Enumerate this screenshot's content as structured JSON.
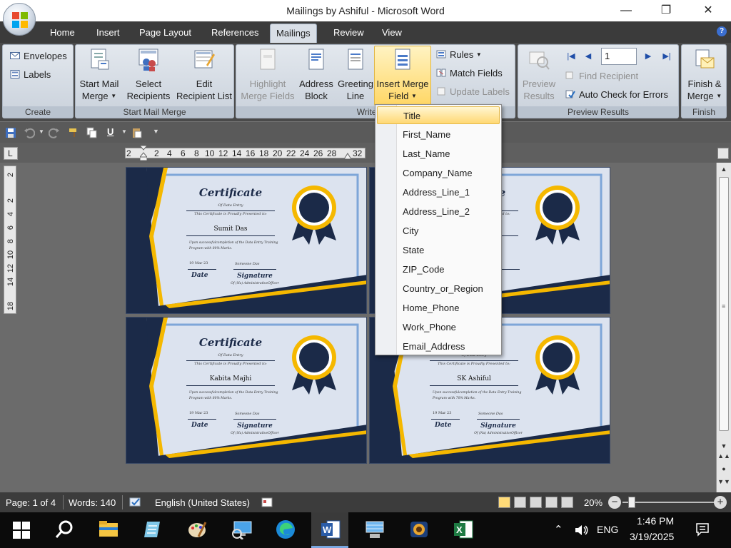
{
  "window": {
    "title": "Mailings by Ashiful - Microsoft Word",
    "controls": {
      "minimize": "—",
      "restore": "❐",
      "close": "✕"
    }
  },
  "tabs": [
    {
      "label": "Home"
    },
    {
      "label": "Insert"
    },
    {
      "label": "Page Layout"
    },
    {
      "label": "References"
    },
    {
      "label": "Mailings",
      "active": true
    },
    {
      "label": "Review"
    },
    {
      "label": "View"
    }
  ],
  "ribbon": {
    "create": {
      "label": "Create",
      "envelopes": "Envelopes",
      "labels": "Labels"
    },
    "start_mail_merge": {
      "label": "Start Mail Merge",
      "start_line1": "Start Mail",
      "start_line2": "Merge",
      "select_line1": "Select",
      "select_line2": "Recipients",
      "edit_line1": "Edit",
      "edit_line2": "Recipient List"
    },
    "write_insert": {
      "label": "Write & In",
      "highlight_line1": "Highlight",
      "highlight_line2": "Merge Fields",
      "address_line1": "Address",
      "address_line2": "Block",
      "greeting_line1": "Greeting",
      "greeting_line2": "Line",
      "insert_line1": "Insert Merge",
      "insert_line2": "Field",
      "rules": "Rules",
      "match_fields": "Match Fields",
      "update_labels": "Update Labels"
    },
    "preview": {
      "label": "Preview Results",
      "preview_line1": "Preview",
      "preview_line2": "Results",
      "record_value": "1",
      "find_recipient": "Find Recipient",
      "auto_check": "Auto Check for Errors"
    },
    "finish": {
      "label": "Finish",
      "finish_line1": "Finish &",
      "finish_line2": "Merge"
    }
  },
  "ruler": {
    "h_ticks": [
      "2",
      "2",
      "4",
      "6",
      "8",
      "10",
      "12",
      "14",
      "16",
      "18",
      "20",
      "22",
      "24",
      "26",
      "28",
      "32"
    ],
    "v_ticks": [
      "2",
      "2",
      "4",
      "6",
      "8",
      "10",
      "12",
      "14",
      "18"
    ]
  },
  "insert_merge_dropdown": {
    "items": [
      {
        "label": "Title",
        "highlighted": true
      },
      {
        "label": "First_Name"
      },
      {
        "label": "Last_Name"
      },
      {
        "label": "Company_Name"
      },
      {
        "label": "Address_Line_1"
      },
      {
        "label": "Address_Line_2"
      },
      {
        "label": "City"
      },
      {
        "label": "State"
      },
      {
        "label": "ZIP_Code"
      },
      {
        "label": "Country_or_Region"
      },
      {
        "label": "Home_Phone"
      },
      {
        "label": "Work_Phone"
      },
      {
        "label": "Email_Address"
      }
    ]
  },
  "certificates": [
    {
      "title": "Certificate",
      "subtitle": "Of Data Entry",
      "presented": "This Certificate is Proudly Presented to:",
      "name": "Sumit Das",
      "body": "Upon successfulcompletion of the Data Entry Training Program with 80% Marks.",
      "date": "19 Mar 23",
      "signature_hand": "Someone Das",
      "date_label": "Date",
      "signature_label": "Signature",
      "role": "Of (Na) AdministrativeOfficer"
    },
    {
      "title": "Certificate",
      "subtitle": "Of Data Entry",
      "presented": "This Certificate is Proudly Presented to:",
      "name": "",
      "body": "",
      "date": "",
      "signature_hand": "",
      "date_label": "",
      "signature_label": "",
      "role": ""
    },
    {
      "title": "Certificate",
      "subtitle": "Of Data Entry",
      "presented": "This Certificate is Proudly Presented to:",
      "name": "Kabita Majhi",
      "body": "Upon successfulcompletion of the Data Entry Training Program with 80% Marks.",
      "date": "19 Mar 23",
      "signature_hand": "Someone Das",
      "date_label": "Date",
      "signature_label": "Signature",
      "role": "Of (Na) AdministrativeOfficer"
    },
    {
      "title": "",
      "subtitle": "Of Data Entry",
      "presented": "This Certificate is Proudly Presented to:",
      "name": "SK Ashiful",
      "body": "Upon successfulcompletion of the Data Entry Training Program with 70% Marks.",
      "date": "19 Mar 23",
      "signature_hand": "Someone Das",
      "date_label": "Date",
      "signature_label": "Signature",
      "role": "Of (Na) AdministrativeOfficer"
    }
  ],
  "status_bar": {
    "page": "Page: 1 of 4",
    "words": "Words: 140",
    "language": "English (United States)",
    "zoom": "20%"
  },
  "taskbar": {
    "apps": [
      "windows-start",
      "search",
      "file-explorer",
      "notepad",
      "paint",
      "remote-desktop",
      "edge",
      "word",
      "computer",
      "media-player",
      "excel"
    ],
    "lang": "ENG",
    "time": "1:46 PM",
    "date": "3/19/2025"
  },
  "colors": {
    "certificate_navy": "#1b2a48",
    "certificate_gold": "#f5b800",
    "highlight": "#ffd873"
  }
}
